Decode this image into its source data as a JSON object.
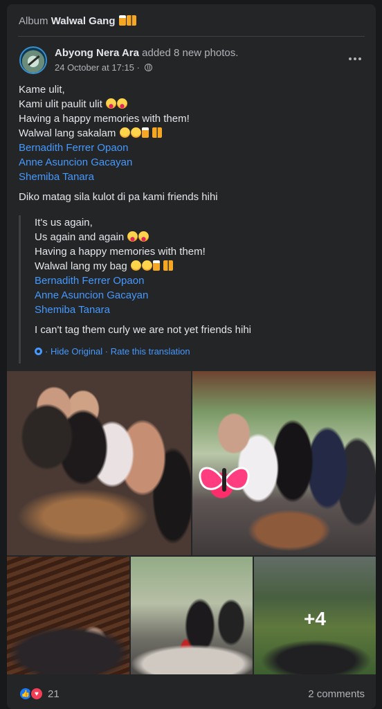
{
  "album": {
    "prefix": "Album",
    "name": "Walwal Gang"
  },
  "post": {
    "author": "Abyong Nera Ara",
    "action": "added 8 new photos.",
    "timestamp": "24 October at 17:15",
    "separator": "·",
    "lines": [
      "Kame ulit,",
      "Kami ulit paulit ulit",
      "Having a happy memories with them!",
      "Walwal lang sakalam"
    ],
    "tags": [
      "Bernadith Ferrer Opaon",
      "Anne Asuncion Gacayan",
      "Shemiba Tanara"
    ],
    "closing": "Diko matag sila kulot di pa kami friends hihi"
  },
  "translation": {
    "lines": [
      "It's us again,",
      "Us again and again",
      "Having a happy memories with them!",
      "Walwal lang my bag"
    ],
    "tags": [
      "Bernadith Ferrer Opaon",
      "Anne Asuncion Gacayan",
      "Shemiba Tanara"
    ],
    "closing": "I can't tag them curly we are not yet friends hihi",
    "hide_original": "Hide Original",
    "dot": "·",
    "rate": "Rate this translation"
  },
  "photos": {
    "more_count": "+4"
  },
  "footer": {
    "reaction_count": "21",
    "comments": "2 comments"
  }
}
